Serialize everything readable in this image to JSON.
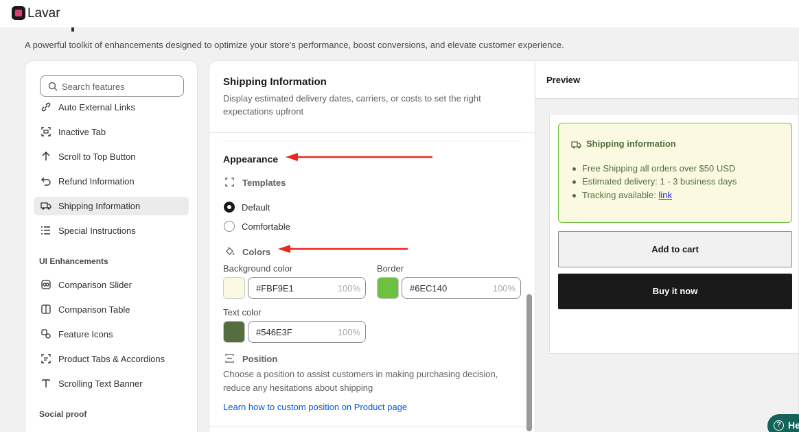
{
  "app": {
    "name": "Lavar"
  },
  "page": {
    "subtitle": "A powerful toolkit of enhancements designed to optimize your store's performance, boost conversions, and elevate customer experience."
  },
  "search": {
    "placeholder": "Search features"
  },
  "sidebar": {
    "items": [
      {
        "label": "Auto External Links",
        "icon": "link-icon"
      },
      {
        "label": "Inactive Tab",
        "icon": "inactive-tab-icon"
      },
      {
        "label": "Scroll to Top Button",
        "icon": "arrow-up-icon"
      },
      {
        "label": "Refund Information",
        "icon": "refund-icon"
      },
      {
        "label": "Shipping Information",
        "icon": "truck-icon",
        "active": true
      },
      {
        "label": "Special Instructions",
        "icon": "list-icon"
      }
    ],
    "section_ui": "UI Enhancements",
    "ui_items": [
      {
        "label": "Comparison Slider",
        "icon": "comparison-slider-icon"
      },
      {
        "label": "Comparison Table",
        "icon": "comparison-table-icon"
      },
      {
        "label": "Feature Icons",
        "icon": "feature-icons-icon"
      },
      {
        "label": "Product Tabs & Accordions",
        "icon": "tabs-icon"
      },
      {
        "label": "Scrolling Text Banner",
        "icon": "text-icon"
      }
    ],
    "section_social": "Social proof"
  },
  "settings": {
    "title": "Shipping Information",
    "description": "Display estimated delivery dates, carriers, or costs to set the right expectations upfront",
    "appearance": "Appearance",
    "templates_label": "Templates",
    "template_options": [
      "Default",
      "Comfortable"
    ],
    "selected_template": "Default",
    "colors_label": "Colors",
    "background_label": "Background color",
    "background_value": "#FBF9E1",
    "background_opacity": "100%",
    "border_label": "Border",
    "border_value": "#6EC140",
    "border_opacity": "100%",
    "text_label": "Text color",
    "text_value": "#546E3F",
    "text_opacity": "100%",
    "position_label": "Position",
    "position_description": "Choose a position to assist customers in making purchasing decision, reduce any hesitations about shipping",
    "position_link": "Learn how to custom position on Product page"
  },
  "preview": {
    "label": "Preview",
    "box_title": "Shipping information",
    "lines": [
      "Free Shipping all orders over $50 USD",
      "Estimated delivery: 1 - 3 business days",
      "Tracking available: "
    ],
    "tracking_link": "link",
    "add_to_cart": "Add to cart",
    "buy_now": "Buy it now"
  },
  "help": {
    "label": "He"
  },
  "colors": {
    "annotation_arrow": "#e8281e",
    "background": "#FBF9E1",
    "border": "#6EC140",
    "text": "#546E3F"
  }
}
